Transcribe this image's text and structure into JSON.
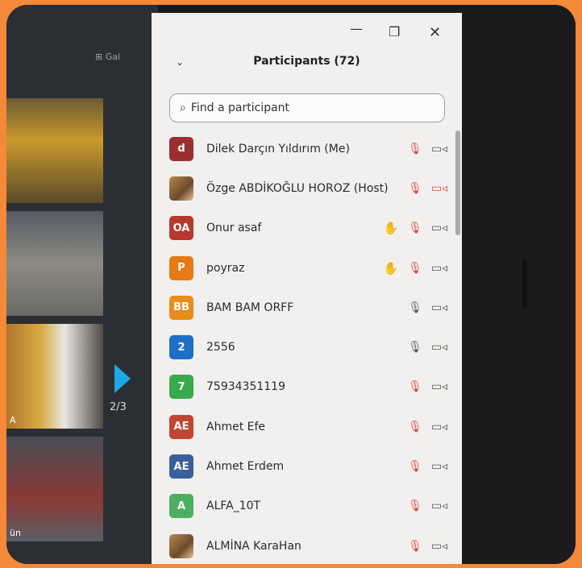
{
  "video": {
    "gallery_label": "⊞ Gal",
    "tiles": [
      {
        "caption": ""
      },
      {
        "caption": ""
      },
      {
        "caption": "A"
      },
      {
        "caption": "ün"
      }
    ],
    "page_indicator": "2/3"
  },
  "panel": {
    "title": "Participants (72)",
    "collapse_glyph": "⌄",
    "window_controls": {
      "minimize": "—",
      "restore": "❐",
      "close": "✕"
    },
    "search": {
      "icon": "⌕",
      "placeholder": "Find a participant"
    }
  },
  "participants": [
    {
      "initials": "d",
      "color": "#9a2f2f",
      "name": "Dilek Darçın Yıldırım (Me)",
      "hand": false,
      "mic": "muted",
      "cam": "on",
      "photo": false
    },
    {
      "initials": "",
      "color": "",
      "name": "Özge ABDİKOĞLU HOROZ (Host)",
      "hand": false,
      "mic": "muted",
      "cam": "off",
      "photo": true
    },
    {
      "initials": "OA",
      "color": "#b8372e",
      "name": "Onur asaf",
      "hand": true,
      "mic": "muted",
      "cam": "on",
      "photo": false
    },
    {
      "initials": "P",
      "color": "#e57a16",
      "name": "poyraz",
      "hand": true,
      "mic": "muted",
      "cam": "on",
      "photo": false
    },
    {
      "initials": "BB",
      "color": "#e88d1a",
      "name": "BAM BAM ORFF",
      "hand": false,
      "mic": "on",
      "cam": "on",
      "photo": false
    },
    {
      "initials": "2",
      "color": "#1e6fc9",
      "name": "2556",
      "hand": false,
      "mic": "on",
      "cam": "on",
      "photo": false
    },
    {
      "initials": "7",
      "color": "#3aa84c",
      "name": "75934351119",
      "hand": false,
      "mic": "muted",
      "cam": "on",
      "photo": false
    },
    {
      "initials": "AE",
      "color": "#c2452f",
      "name": "Ahmet Efe",
      "hand": false,
      "mic": "muted",
      "cam": "on",
      "photo": false
    },
    {
      "initials": "AE",
      "color": "#3b5f9a",
      "name": "Ahmet Erdem",
      "hand": false,
      "mic": "muted",
      "cam": "on",
      "photo": false
    },
    {
      "initials": "A",
      "color": "#4caf60",
      "name": "ALFA_10T",
      "hand": false,
      "mic": "muted",
      "cam": "on",
      "photo": false
    },
    {
      "initials": "",
      "color": "",
      "name": "ALMİNA KaraHan",
      "hand": false,
      "mic": "muted",
      "cam": "on",
      "photo": true
    }
  ],
  "icons": {
    "hand": "✋",
    "mic_muted": "🎙",
    "mic_on": "🎙",
    "cam_on": "▭◃",
    "cam_off": "▭◃"
  }
}
